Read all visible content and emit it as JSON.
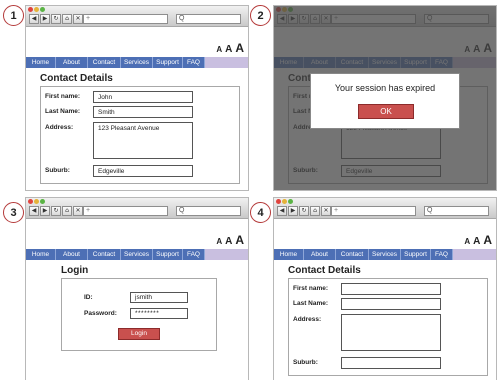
{
  "steps": [
    "1",
    "2",
    "3",
    "4"
  ],
  "browser": {
    "new_tab": "+",
    "search": "Q"
  },
  "text_size": [
    "A",
    "A",
    "A"
  ],
  "nav": [
    "Home",
    "About",
    "Contact",
    "Services",
    "Support",
    "FAQ"
  ],
  "contact": {
    "title": "Contact Details",
    "labels": {
      "first": "First name:",
      "last": "Last Name:",
      "address": "Address:",
      "suburb": "Suburb:"
    },
    "values": {
      "first": "John",
      "last": "Smith",
      "address": "123 Pleasant Avenue",
      "suburb": "Edgeville"
    }
  },
  "modal": {
    "message": "Your session has expired",
    "ok": "OK"
  },
  "login": {
    "title": "Login",
    "id_label": "ID:",
    "password_label": "Password:",
    "id_value": "jsmith",
    "password_value": "********",
    "button": "Login"
  },
  "colors": {
    "nav": "#4d6fb5",
    "accent": "#c9504e",
    "step_ring": "#b43a3a"
  },
  "icons": [
    "back-icon",
    "forward-icon",
    "reload-icon",
    "home-icon",
    "stop-icon",
    "search-icon"
  ]
}
